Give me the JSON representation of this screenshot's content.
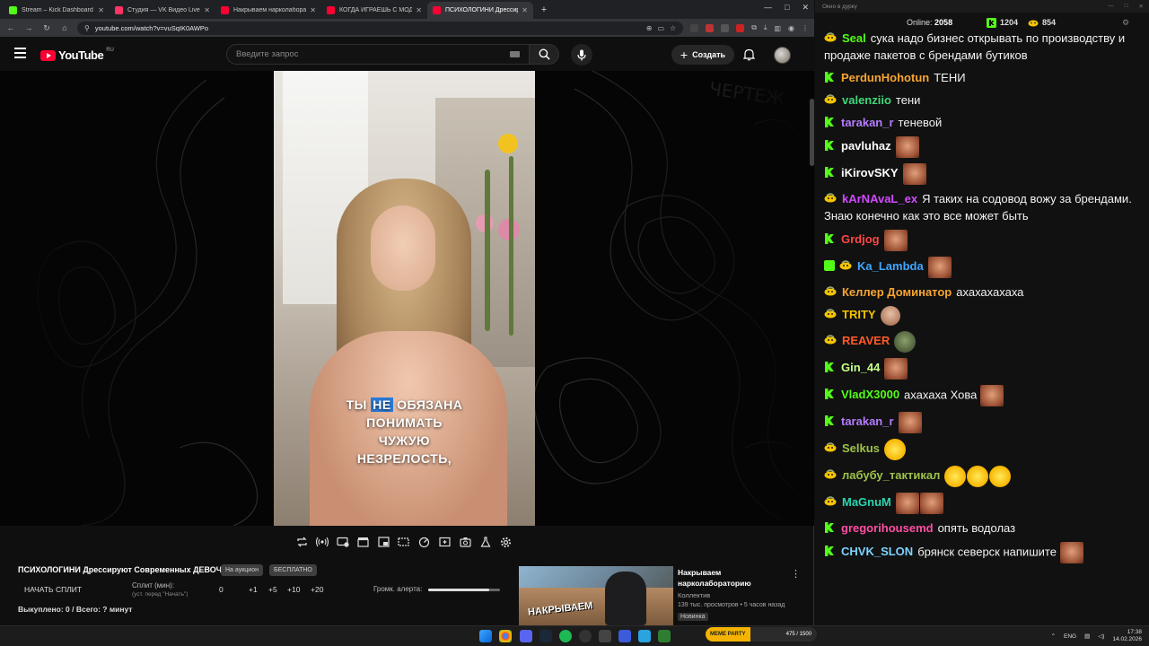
{
  "browser": {
    "tabs": [
      {
        "title": "Stream – Kick Dashboard",
        "icon": "kick-icon",
        "color": "#53fc18",
        "active": false
      },
      {
        "title": "Студия — VK Видео Live",
        "icon": "vk-video-icon",
        "color": "#ff3366",
        "active": false
      },
      {
        "title": "Накрываем нарколабораторию",
        "icon": "youtube-icon",
        "color": "#ff0033",
        "active": false
      },
      {
        "title": "КОГДА ИГРАЕШЬ С МОДАМИ",
        "icon": "youtube-icon",
        "color": "#ff0033",
        "active": false
      },
      {
        "title": "ПСИХОЛОГИНИ Дрессируют",
        "icon": "youtube-icon",
        "color": "#ff0033",
        "active": true
      }
    ],
    "url": "youtube.com/watch?v=vuSqIK0AWPo"
  },
  "youtube": {
    "logo_text": "YouTube",
    "region": "RU",
    "search_placeholder": "Введите запрос",
    "create_label": "Создать"
  },
  "video": {
    "caption_lines": [
      {
        "pre": "ТЫ ",
        "hl": "НЕ",
        "post": " ОБЯЗАНА"
      },
      {
        "pre": "ПОНИМАТЬ",
        "hl": "",
        "post": ""
      },
      {
        "pre": "ЧУЖУЮ",
        "hl": "",
        "post": ""
      },
      {
        "pre": "НЕЗРЕЛОСТЬ,",
        "hl": "",
        "post": ""
      }
    ],
    "title": "ПСИХОЛОГИНИ Дрессируют Современных ДЕВОЧЕК",
    "chip_1": "На аукцион",
    "chip_2": "БЕСПЛАТНО",
    "split": {
      "start_label": "НАЧАТЬ СПЛИТ",
      "label": "Сплит (мин):",
      "hint": "(уст. перед \"Начать\")",
      "value": "0",
      "buttons": [
        "+1",
        "+5",
        "+10",
        "+20"
      ]
    },
    "alert_label": "Громк. алерта:",
    "alert_volume": 0.85,
    "bought_text": "Выкуплено: 0 / Всего: ? минут"
  },
  "recommended": {
    "thumb_text": "НАКРЫВАЕМ",
    "title": "Накрываем нарколабораторию",
    "channel": "Коллектив",
    "meta": "139 тыс. просмотров • 5 часов назад",
    "badge": "Новинка"
  },
  "chat": {
    "window_title": "Окно в дурку",
    "online_label": "Online:",
    "online_count": "2058",
    "kick_count": "1204",
    "vk_count": "854",
    "colors": {
      "kick": "#53fc18",
      "vk": "#f5c400"
    },
    "messages": [
      {
        "platform": "vk",
        "nick": "Seal",
        "color": "#53fc18",
        "text": "сука надо бизнес открывать по производству и продаже пакетов с брендами бутиков",
        "emotes": []
      },
      {
        "platform": "kick",
        "nick": "PerdunHohotun",
        "color": "#f7a534",
        "text": "ТЕНИ",
        "emotes": []
      },
      {
        "platform": "vk",
        "nick": "valenziio",
        "color": "#42d67a",
        "text": "тени",
        "emotes": []
      },
      {
        "platform": "kick",
        "nick": "tarakan_r",
        "color": "#b57cff",
        "text": "теневой",
        "emotes": []
      },
      {
        "platform": "kick",
        "nick": "pavluhaz",
        "color": "#ffffff",
        "text": "",
        "emotes": [
          "face"
        ]
      },
      {
        "platform": "kick",
        "nick": "iKirovSKY",
        "color": "#ffffff",
        "text": "",
        "emotes": [
          "face"
        ]
      },
      {
        "platform": "vk",
        "nick": "kArNAvaL_ex",
        "color": "#d04bff",
        "text": "Я таких на содовод вожу за брендами. Знаю конечно как это все может быть",
        "emotes": []
      },
      {
        "platform": "kick",
        "nick": "Grdjog",
        "color": "#ff4646",
        "text": "",
        "emotes": [
          "face"
        ]
      },
      {
        "platform": "vk-mod",
        "nick": "Ka_Lambda",
        "color": "#3ea6ff",
        "text": "",
        "emotes": [
          "face"
        ]
      },
      {
        "platform": "vk",
        "nick": "Келлер Доминатор",
        "color": "#f7a534",
        "text": "ахахахахаха",
        "emotes": []
      },
      {
        "platform": "vk",
        "nick": "TRITY",
        "color": "#f5c400",
        "text": "",
        "emotes": [
          "bald"
        ]
      },
      {
        "platform": "vk",
        "nick": "REAVER",
        "color": "#ff5a2a",
        "text": "",
        "emotes": [
          "zombie"
        ]
      },
      {
        "platform": "kick",
        "nick": "Gin_44",
        "color": "#c8ff8a",
        "text": "",
        "emotes": [
          "face"
        ]
      },
      {
        "platform": "kick",
        "nick": "VladX3000",
        "color": "#53fc18",
        "text": "ахахаха Хова",
        "emotes": [
          "face"
        ]
      },
      {
        "platform": "kick",
        "nick": "tarakan_r",
        "color": "#b57cff",
        "text": "",
        "emotes": [
          "face"
        ]
      },
      {
        "platform": "vk",
        "nick": "Selkus",
        "color": "#9ec24a",
        "text": "",
        "emotes": [
          "lol"
        ]
      },
      {
        "platform": "vk",
        "nick": "лабубу_тактикал",
        "color": "#9ec24a",
        "text": "",
        "emotes": [
          "lol",
          "lol",
          "lol"
        ]
      },
      {
        "platform": "vk",
        "nick": "MaGnuM",
        "color": "#2ad6b0",
        "text": "",
        "emotes": [
          "face",
          "face"
        ]
      },
      {
        "platform": "kick",
        "nick": "gregorihousemd",
        "color": "#ff4fa3",
        "text": "опять водолаз",
        "emotes": []
      },
      {
        "platform": "kick",
        "nick": "CHVK_SLON",
        "color": "#7fd3ff",
        "text": "брянск северск напишите",
        "emotes": [
          "face"
        ]
      }
    ]
  },
  "taskbar": {
    "lang": "ENG",
    "time": "17:38",
    "date": "14.02.2026",
    "widget_label": "MEME PARTY",
    "widget_value": "475 / 1500"
  }
}
